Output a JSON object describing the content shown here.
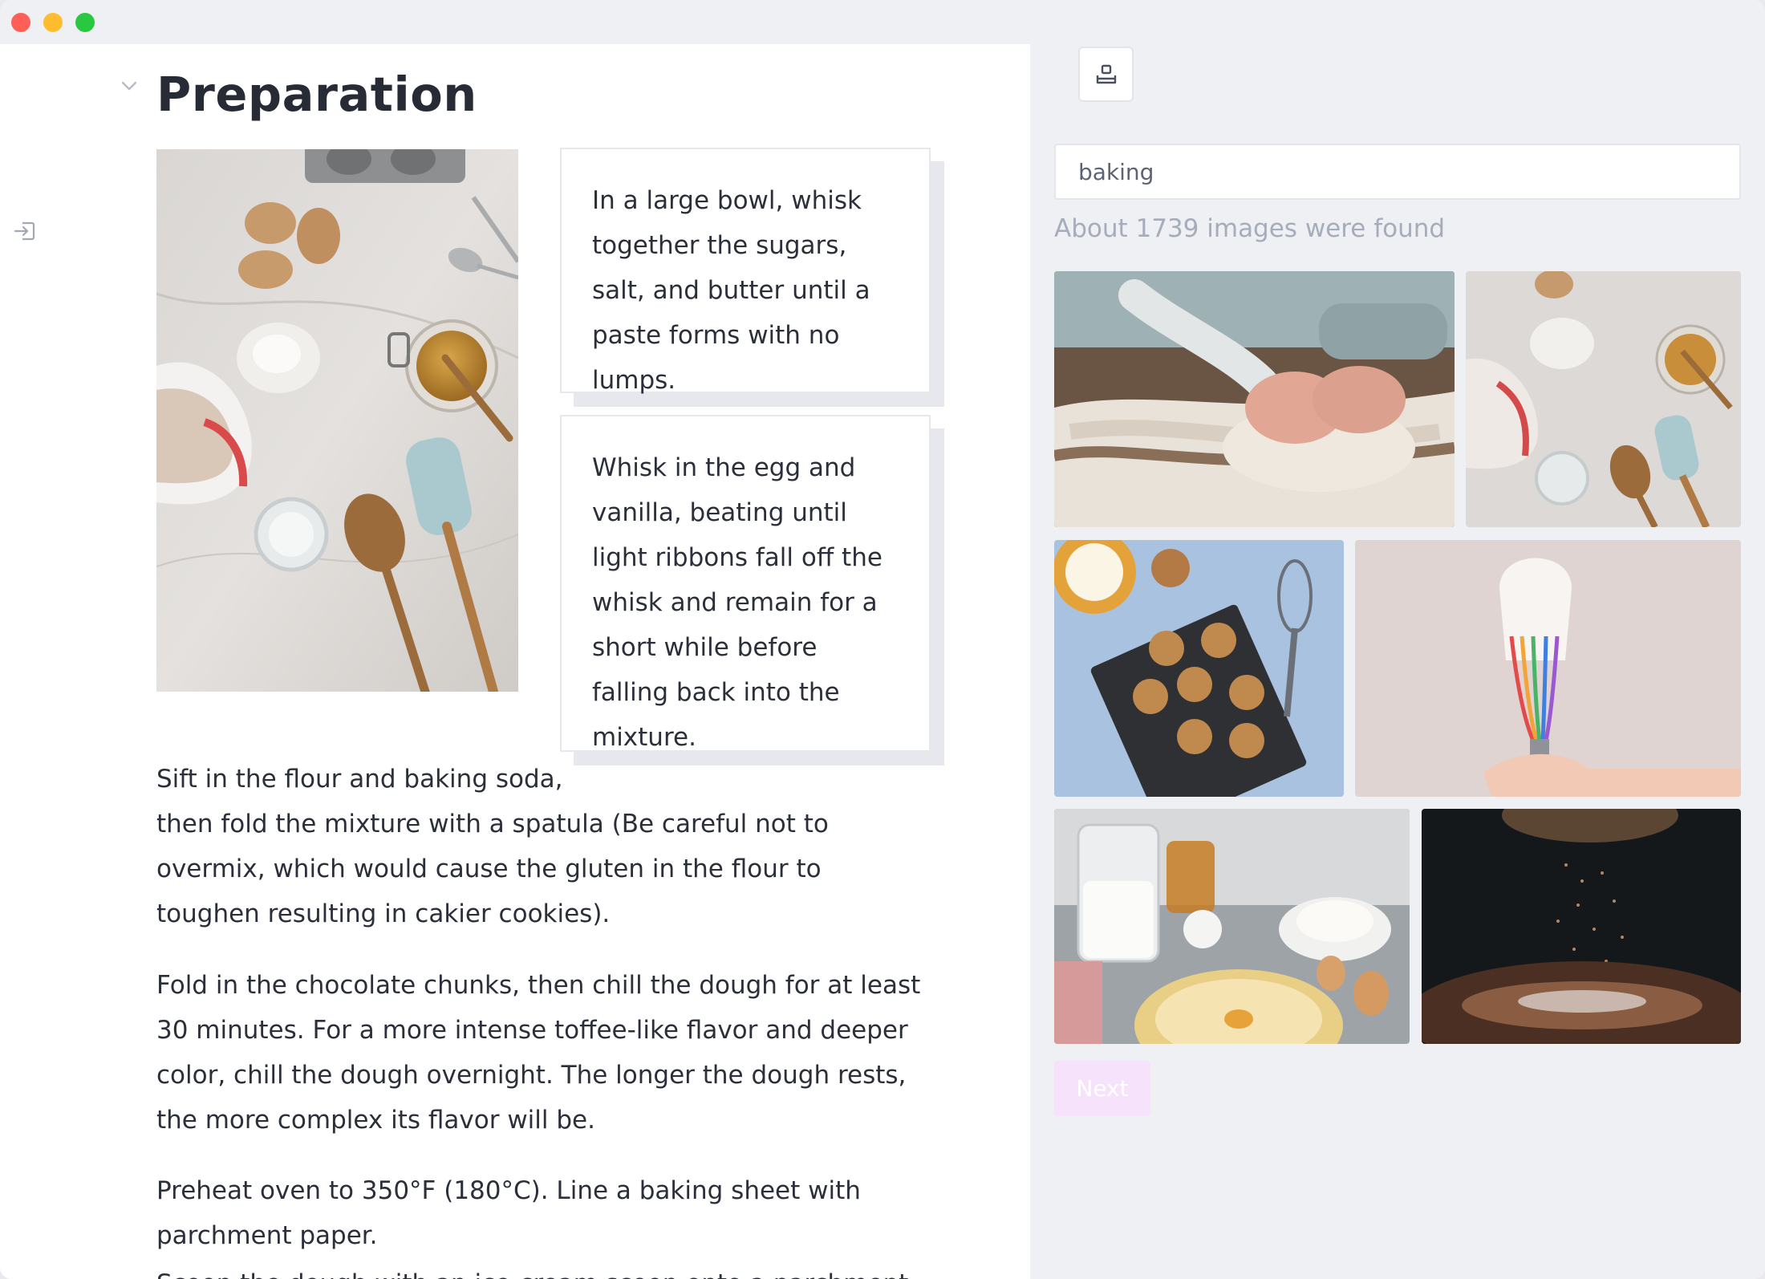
{
  "window": {
    "controls": [
      "close",
      "minimize",
      "maximize"
    ]
  },
  "document": {
    "title": "Preparation",
    "hero_image": "baking ingredients flat lay with eggs, flour, honey jar, spatula and wooden spoon",
    "cards": [
      "In a large bowl, whisk together the sugars, salt, and butter until a paste forms with no lumps.",
      "Whisk in the egg and vanilla, beating until light ribbons fall off the whisk and remain for a short while before falling back into the mixture."
    ],
    "paragraphs": [
      {
        "line1": "Sift in the flour and baking soda,",
        "rest": "then fold the mixture with a spatula (Be careful not to overmix, which would cause the gluten in the flour to toughen resulting in cakier cookies)."
      },
      "Fold in the chocolate chunks, then chill the dough for at least 30 minutes. For a more intense toffee-like flavor and deeper color, chill the dough overnight. The longer the dough rests, the more complex its flavor will be.",
      "Preheat oven to 350°F (180°C). Line a baking sheet with parchment paper.",
      "Scoop the dough with an ice-cream scoop onto a parchment"
    ]
  },
  "image_search": {
    "query": "baking",
    "result_count": "About 1739 images were found",
    "results": [
      "hands kneading dough on floured table",
      "baking ingredients flat lay",
      "chocolate chip cookies on cooling rack with milk and whisk",
      "hand holding colorful whisk with cream",
      "mixing bowl with eggs, flour and honey",
      "cocoa powder sifted over cake"
    ],
    "next_label": "Next"
  },
  "icons": {
    "chevron": "chevron-down-icon",
    "sidebar": "sidebar-toggle-icon",
    "toolbar": "image-upload-icon"
  },
  "colors": {
    "title_text": "#272b36",
    "body_text": "#2b2f3a",
    "muted_text": "#a7acbb",
    "panel_bg": "#eef0f3",
    "next_button_bg": "#f6e2fb",
    "close_dot": "#fe5f57",
    "minimize_dot": "#febc2e",
    "maximize_dot": "#28c840"
  }
}
